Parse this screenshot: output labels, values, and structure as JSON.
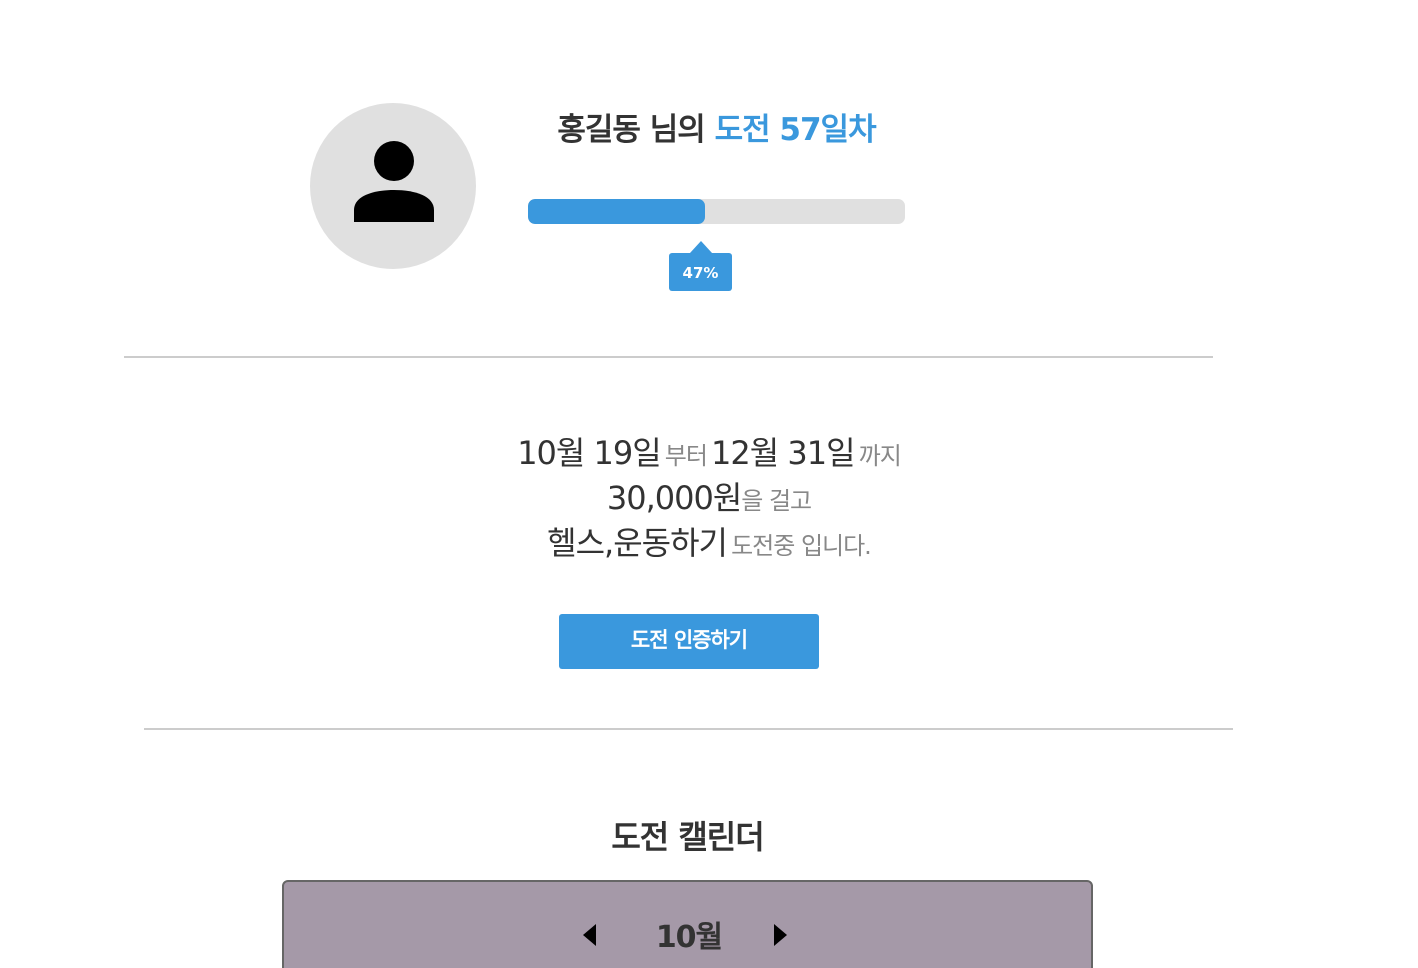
{
  "profile": {
    "avatar_icon": "user-icon",
    "user_name": "홍길동",
    "name_suffix": " 님의 ",
    "challenge_label": "도전 57일차"
  },
  "progress": {
    "percent": 47,
    "label": "47%",
    "color": "#3a98dd"
  },
  "challenge": {
    "start_date": "10월 19일",
    "from_word": "부터",
    "end_date": "12월 31일",
    "until_word": "까지",
    "amount": "30,000원",
    "amount_suffix": "을 걸고",
    "activity": "헬스,운동하기",
    "status_text": "도전중 입니다."
  },
  "certify_button": {
    "label": "도전 인증하기"
  },
  "calendar": {
    "heading": "도전 캘린더",
    "month": "10월",
    "prev_icon": "caret-left-icon",
    "next_icon": "caret-right-icon",
    "background_color": "#a599a8"
  }
}
